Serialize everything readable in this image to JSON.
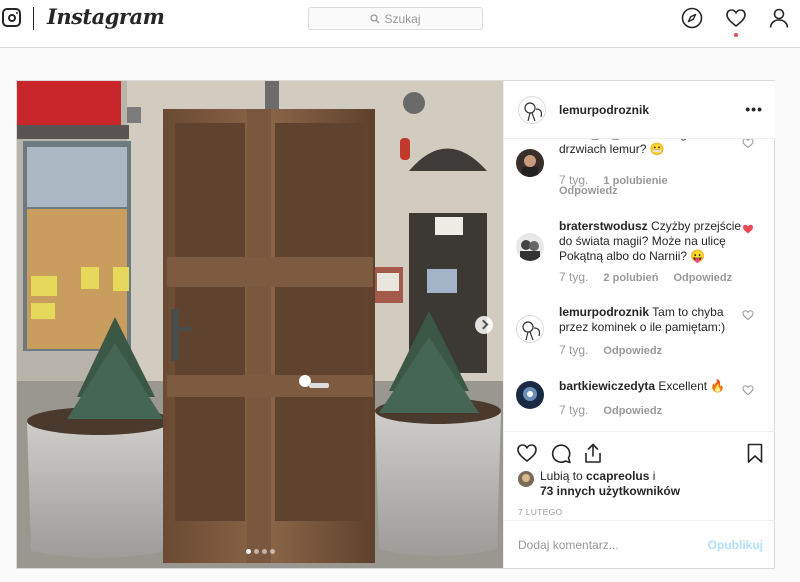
{
  "app": {
    "name": "Instagram"
  },
  "search": {
    "placeholder": "Szukaj"
  },
  "nav_icons": [
    "explore-compass-icon",
    "activity-heart-icon",
    "profile-icon"
  ],
  "post": {
    "author": "lemurpodroznik",
    "carousel": {
      "slides": 4,
      "current": 1
    },
    "comments": [
      {
        "user": "umier_de_bier",
        "text": "Na drugich drzwiach lemur? 😬",
        "time": "7 tyg.",
        "likes": "1 polubienie",
        "reply": "Odpowiedz",
        "liked": false
      },
      {
        "user": "braterstwodusz",
        "text": "Czyżby przejście do świata magii? Może na ulicę Pokątną albo do Narnii? 😛",
        "time": "7 tyg.",
        "likes": "2 polubień",
        "reply": "Odpowiedz",
        "liked": true
      },
      {
        "user": "lemurpodroznik",
        "text": "Tam to chyba przez kominek o ile pamiętam:)",
        "time": "7 tyg.",
        "reply": "Odpowiedz",
        "liked": false
      },
      {
        "user": "bartkiewiczedyta",
        "text": "Excellent 🔥",
        "time": "7 tyg.",
        "reply": "Odpowiedz",
        "liked": false
      }
    ],
    "likes_line1_prefix": "Lubią to",
    "likes_user": "ccapreolus",
    "likes_line1_suffix": "i",
    "likes_line2": "73 innych użytkowników",
    "date": "7 LUTEGO",
    "add_comment_placeholder": "Dodaj komentarz...",
    "publish_label": "Opublikuj"
  },
  "colors": {
    "like_red": "#ed4956",
    "publish_disabled": "#b2dffc",
    "meta_gray": "#999999"
  }
}
